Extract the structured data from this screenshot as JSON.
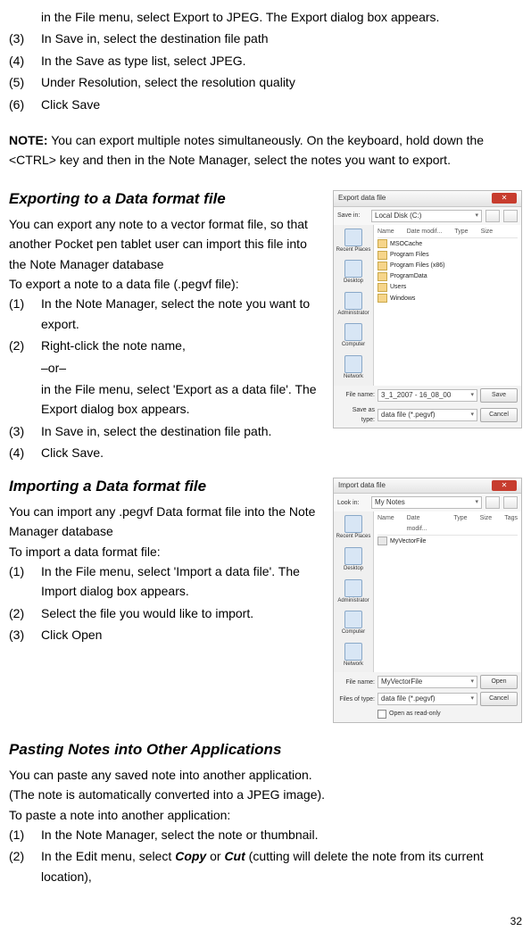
{
  "intro_steps": {
    "pre_line": "in the File menu, select Export to JPEG. The Export dialog box appears.",
    "items": [
      {
        "num": "(3)",
        "text": "In Save in, select the destination file path"
      },
      {
        "num": "(4)",
        "text": "In the Save as type list, select JPEG."
      },
      {
        "num": "(5)",
        "text": "Under Resolution, select the resolution quality"
      },
      {
        "num": "(6)",
        "text": "Click Save"
      }
    ]
  },
  "note": {
    "label": "NOTE:",
    "text": " You can export multiple notes simultaneously. On the keyboard, hold down the <CTRL> key and then in the Note Manager, select the notes you want to export."
  },
  "export_section": {
    "heading": "Exporting to a Data format file",
    "intro": [
      "You can export any note to a vector format file, so that another Pocket pen tablet user can import this file into the Note Manager database",
      "To export a note to a data file (.pegvf file):"
    ],
    "items": [
      {
        "num": "(1)",
        "text": "In the Note Manager, select the note you want to export."
      },
      {
        "num": "(2)",
        "text": "Right-click the note name,"
      },
      {
        "num": "",
        "text": "–or–"
      },
      {
        "num": "",
        "text": "in the File menu, select 'Export as a data file'. The Export dialog box appears."
      },
      {
        "num": "(3)",
        "text": "In Save in, select the destination file path."
      },
      {
        "num": "(4)",
        "text": "Click Save."
      }
    ],
    "dialog": {
      "title": "Export data file",
      "savein_label": "Save in:",
      "savein_value": "Local Disk (C:)",
      "cols": [
        "Name",
        "Date modif...",
        "Type",
        "Size"
      ],
      "files": [
        "MSOCache",
        "Program Files",
        "Program Files (x86)",
        "ProgramData",
        "Users",
        "Windows"
      ],
      "places": [
        "Recent Places",
        "Desktop",
        "Administrator",
        "Computer",
        "Network"
      ],
      "filename_label": "File name:",
      "filename_value": "3_1_2007 - 16_08_00",
      "type_label": "Save as type:",
      "type_value": "data file (*.pegvf)",
      "save_btn": "Save",
      "cancel_btn": "Cancel"
    }
  },
  "import_section": {
    "heading": "Importing a Data format file",
    "intro": [
      "You can import any .pegvf Data format file into the Note Manager database",
      "To import a data format file:"
    ],
    "items": [
      {
        "num": "(1)",
        "text": "In the File menu, select 'Import a data file'. The Import dialog box appears."
      },
      {
        "num": "(2)",
        "text": "Select the file you would like to import."
      },
      {
        "num": "(3)",
        "text": "Click Open"
      }
    ],
    "dialog": {
      "title": "Import data file",
      "lookin_label": "Look in:",
      "lookin_value": "My Notes",
      "cols": [
        "Name",
        "Date modif...",
        "Type",
        "Size",
        "Tags"
      ],
      "files": [
        "MyVectorFile"
      ],
      "places": [
        "Recent Places",
        "Desktop",
        "Administrator",
        "Computer",
        "Network"
      ],
      "filename_label": "File name:",
      "filename_value": "MyVectorFile",
      "type_label": "Files of type:",
      "type_value": "data file (*.pegvf)",
      "open_btn": "Open",
      "cancel_btn": "Cancel",
      "readonly_label": "Open as read-only"
    }
  },
  "paste_section": {
    "heading": "Pasting Notes into Other Applications",
    "intro": [
      "You can paste any saved note into another application.",
      "(The note is automatically converted into a JPEG image).",
      "To paste a note into another application:"
    ],
    "items": [
      {
        "num": "(1)",
        "text": "In the Note Manager, select the note or thumbnail."
      },
      {
        "num": "(2)",
        "pre": "In the Edit menu, select ",
        "copy": "Copy",
        "mid": " or ",
        "cut": "Cut",
        "post": " (cutting will delete the note from its current location),"
      }
    ]
  },
  "page_number": "32"
}
